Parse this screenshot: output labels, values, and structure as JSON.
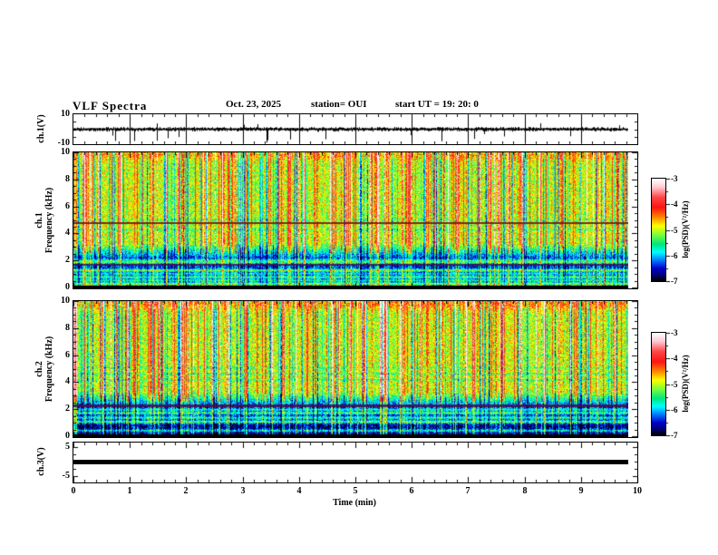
{
  "header": {
    "title": "VLF Spectra",
    "date": "Oct. 23, 2025",
    "station": "station= OUI",
    "start_ut": "start UT  =   19: 20: 0"
  },
  "labels": {
    "ch1_voltage": "ch.1(V)",
    "ch1_freq": "ch.1\nFrequency (kHz)",
    "ch2_freq": "ch.2\nFrequency (kHz)",
    "ch3_voltage": "ch.3(V)",
    "time_axis": "Time (min)",
    "colorbar_units": "log(PSD)(V²/Hz)"
  },
  "axes": {
    "x_tick_labels": [
      "0",
      "1",
      "2",
      "3",
      "4",
      "5",
      "6",
      "7",
      "8",
      "9",
      "10"
    ],
    "wave_y_tick_labels": [
      "10",
      "-10"
    ],
    "spec_y_tick_labels": [
      "0",
      "2",
      "4",
      "6",
      "8",
      "10"
    ],
    "ch3_y_tick_labels": [
      "5",
      "-5"
    ],
    "colorbar_tick_labels": [
      "-3",
      "-4",
      "-5",
      "-6",
      "-7"
    ]
  },
  "chart_data": {
    "type": "heatmap",
    "title": "VLF Spectra",
    "subtitle": "Oct. 23, 2025  station= OUI  start UT = 19:20:0",
    "time_axis": {
      "label": "Time (min)",
      "min": 0,
      "max": 10,
      "major_tick": 1,
      "minor_tick": 0.2,
      "data_end_min": 9.82
    },
    "legend_position": "two colorbars at right, ticks -3 to -7, label log(PSD)(V²/Hz)",
    "panels": [
      {
        "id": "ch1_waveform",
        "type": "line",
        "ylabel": "ch.1(V)",
        "ylim": [
          -10,
          10
        ],
        "yticks": [
          10,
          -10
        ],
        "description": "Dense broadband noise waveform centred on 0 V (typically ±2 V) with intermittent impulsive spikes, mostly negative, reaching about -9 V; vertical gridlines at each minute",
        "render": {
          "seed": 11,
          "sigma": 1.0,
          "down_spikes": 17,
          "down_depth": [
            3,
            9
          ],
          "up_spikes": 5,
          "up_height": [
            2,
            4.5
          ]
        }
      },
      {
        "id": "ch1_spectrogram",
        "type": "spectrogram",
        "ylabel": "ch.1 Frequency (kHz)",
        "ylim": [
          0,
          10
        ],
        "zscale": {
          "label": "log(PSD)(V²/Hz)",
          "min": -7,
          "max": -3
        },
        "description": "Broadband VLF spectrogram: green/yellow background above ~3 kHz crossed by many vertical red/orange sferic streaks and darker blue streaks; dark blue band below ~2.5 kHz with thin bright horizontal lines; dark-red interference line near 4.8 kHz and dark purple line near 1.65 kHz",
        "render": {
          "seed": 7,
          "base_high": -5.0,
          "base_low": -6.45,
          "transition": [
            2.2,
            3.3
          ],
          "noise": 0.9,
          "bands": [
            [
              0.3,
              1.4,
              0.07
            ],
            [
              0.55,
              0.8,
              0.07
            ],
            [
              0.8,
              1.0,
              0.07
            ],
            [
              1.05,
              0.7,
              0.07
            ],
            [
              1.3,
              1.2,
              0.07
            ],
            [
              1.9,
              1.0,
              0.07
            ],
            [
              2.05,
              0.7,
              0.07
            ],
            [
              4.3,
              -0.4,
              0.05
            ],
            [
              5.05,
              -0.35,
              0.05
            ],
            [
              9.8,
              0.4,
              0.25
            ]
          ],
          "lines": [
            [
              4.78,
              "#6b1010",
              0.85,
              2
            ],
            [
              1.65,
              "#4a0a4a",
              0.8,
              2
            ]
          ],
          "left_cols": 0,
          "left_boost": 0
        }
      },
      {
        "id": "ch2_spectrogram",
        "type": "spectrogram",
        "ylabel": "ch.2 Frequency (kHz)",
        "ylim": [
          0,
          10
        ],
        "zscale": {
          "label": "log(PSD)(V²/Hz)",
          "min": -7,
          "max": -3
        },
        "description": "Same character as ch.1: green background with red sferic streaks above ~3 kHz, strong red column at the very start of the record, dark blue band below ~2.5 kHz, dark purple interference band near 2.25 kHz, extra-dark floor below ~0.9 kHz",
        "render": {
          "seed": 23,
          "base_high": -5.0,
          "base_low": -6.45,
          "transition": [
            2.2,
            3.3
          ],
          "noise": 0.9,
          "bands": [
            [
              0.45,
              0.9,
              0.07
            ],
            [
              1.1,
              1.1,
              0.07
            ],
            [
              1.4,
              0.9,
              0.07
            ],
            [
              1.75,
              1.0,
              0.07
            ],
            [
              2.0,
              0.8,
              0.07
            ],
            [
              4.2,
              -0.4,
              0.05
            ],
            [
              4.65,
              -0.45,
              0.05
            ],
            [
              5.1,
              -0.35,
              0.05
            ],
            [
              9.8,
              0.55,
              0.3
            ]
          ],
          "lines": [
            [
              2.25,
              "#4a0a4a",
              0.85,
              3
            ]
          ],
          "left_cols": 4,
          "left_boost": 1.5,
          "low_floor": [
            0.9,
            -6.7
          ]
        }
      },
      {
        "id": "ch3_waveform",
        "type": "line",
        "ylabel": "ch.3(V)",
        "ylim": [
          -5,
          5
        ],
        "yticks": [
          5,
          -5
        ],
        "value": 0,
        "description": "Constant 0 V — thick flat black line across the full record"
      }
    ],
    "colormap_stops": [
      [
        0,
        "#ffffff"
      ],
      [
        0.08,
        "#ffc8d2"
      ],
      [
        0.18,
        "#ff4646"
      ],
      [
        0.28,
        "#fa1414"
      ],
      [
        0.38,
        "#ff8c00"
      ],
      [
        0.46,
        "#ffff00"
      ],
      [
        0.55,
        "#78ff3c"
      ],
      [
        0.64,
        "#00e67d"
      ],
      [
        0.72,
        "#00ffff"
      ],
      [
        0.8,
        "#0078ff"
      ],
      [
        0.88,
        "#0000c8"
      ],
      [
        0.95,
        "#00006e"
      ],
      [
        1,
        "#000000"
      ]
    ]
  }
}
